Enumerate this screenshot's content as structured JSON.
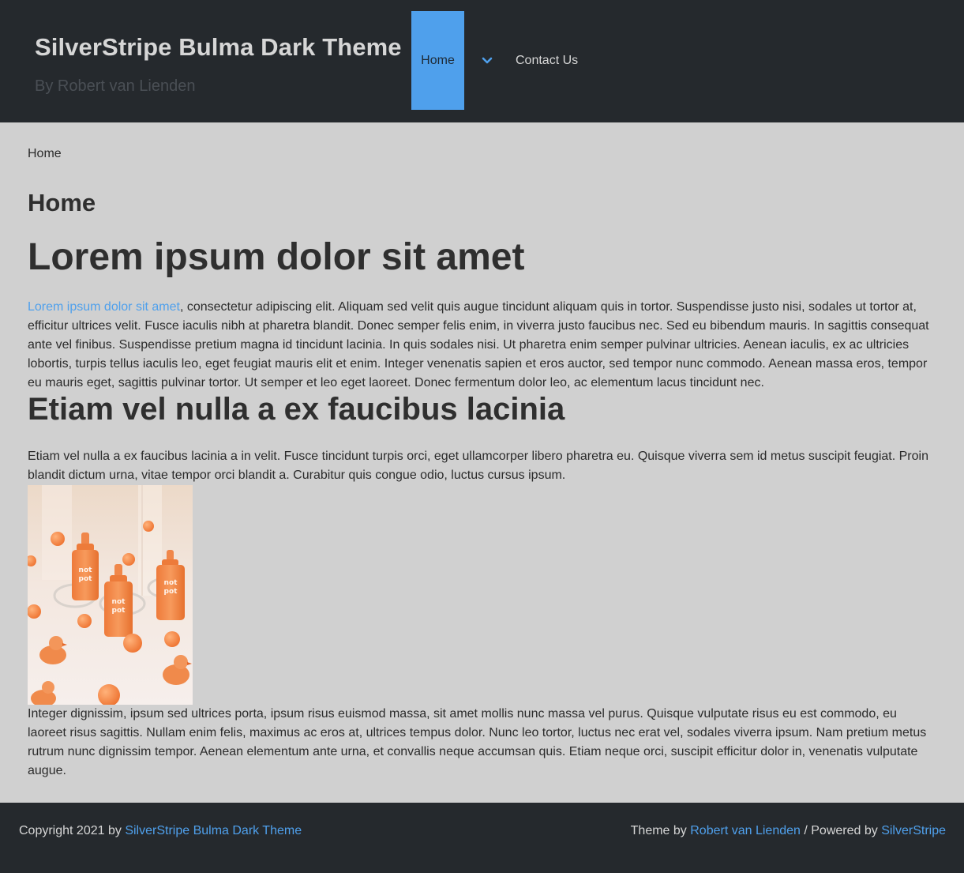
{
  "header": {
    "site_title": "SilverStripe Bulma Dark Theme",
    "site_subtitle": "By Robert van Lienden",
    "nav": {
      "home_label": "Home",
      "dropdown_icon": "chevron-down-icon",
      "contact_label": "Contact Us"
    }
  },
  "breadcrumb": {
    "current": "Home"
  },
  "content": {
    "page_title": "Home",
    "heading1": "Lorem ipsum dolor sit amet",
    "p1_link": "Lorem ipsum dolor sit amet",
    "p1_text": ", consectetur adipiscing elit. Aliquam sed velit quis augue tincidunt aliquam quis in tortor. Suspendisse justo nisi, sodales ut tortor at, efficitur ultrices velit. Fusce iaculis nibh at pharetra blandit. Donec semper felis enim, in viverra justo faucibus nec. Sed eu bibendum mauris. In sagittis consequat ante vel finibus. Suspendisse pretium magna id tincidunt lacinia. In quis sodales nisi. Ut pharetra enim semper pulvinar ultricies. Aenean iaculis, ex ac ultricies lobortis, turpis tellus iaculis leo, eget feugiat mauris elit et enim. Integer venenatis sapien et eros auctor, sed tempor nunc commodo. Aenean massa eros, tempor eu mauris eget, sagittis pulvinar tortor. Ut semper et leo eget laoreet. Donec fermentum dolor leo, ac elementum lacus tincidunt nec.",
    "heading2": "Etiam vel nulla a ex faucibus lacinia",
    "p2_text": "Etiam vel nulla a ex faucibus lacinia a in velit. Fusce tincidunt turpis orci, eget ullamcorper libero pharetra eu. Quisque viverra sem id metus suscipit feugiat. Proin blandit dictum urna, vitae tempor orci blandit a. Curabitur quis congue odio, luctus cursus ipsum.",
    "image_label_top": "not",
    "image_label_bottom": "pot",
    "p3_text": "Integer dignissim, ipsum sed ultrices porta, ipsum risus euismod massa, sit amet mollis nunc massa vel purus. Quisque vulputate risus eu est commodo, eu laoreet risus sagittis. Nullam enim felis, maximus ac eros at, ultrices tempus dolor. Nunc leo tortor, luctus nec erat vel, sodales viverra ipsum. Nam pretium metus rutrum nunc dignissim tempor. Aenean elementum ante urna, et convallis neque accumsan quis. Etiam neque orci, suscipit efficitur dolor in, venenatis vulputate augue."
  },
  "footer": {
    "copyright_prefix": "Copyright 2021 by ",
    "copyright_link": "SilverStripe Bulma Dark Theme",
    "theme_prefix": "Theme by ",
    "theme_author_link": "Robert van Lienden",
    "powered_prefix": " / Powered by ",
    "powered_link": "SilverStripe"
  },
  "colors": {
    "header_bg": "#25292d",
    "page_bg": "#d0d0d0",
    "accent": "#4fa0ec",
    "text_dark": "#2f2f2f",
    "text_light": "#d6d6d6",
    "subtitle": "#4a4f55"
  }
}
